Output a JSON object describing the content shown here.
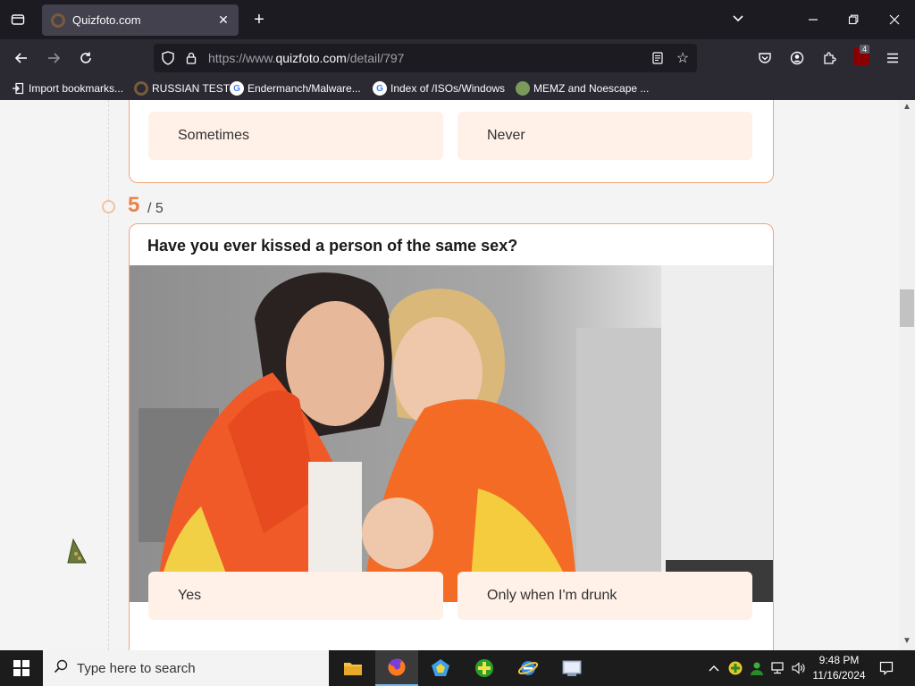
{
  "browser": {
    "tab": {
      "title": "Quizfoto.com"
    },
    "url": {
      "prefix": "https://www.",
      "domain": "quizfoto.com",
      "path": "/detail/797"
    },
    "ublock_badge": "4",
    "bookmarks": [
      {
        "label": "Import bookmarks..."
      },
      {
        "label": "RUSSIAN TEST"
      },
      {
        "label": "Endermanch/Malware..."
      },
      {
        "label": "Index of /ISOs/Windows"
      },
      {
        "label": "MEMZ and Noescape ..."
      }
    ]
  },
  "quiz": {
    "previous_answers": [
      {
        "label": "Sometimes"
      },
      {
        "label": "Never"
      }
    ],
    "question": {
      "number": "5",
      "total": "/ 5",
      "title": "Have you ever kissed a person of the same sex?",
      "image_alt": "Two women wrapped in a rainbow flag",
      "answers": [
        {
          "label": "Yes"
        },
        {
          "label": "Only when I'm drunk"
        }
      ]
    },
    "colors": {
      "accent": "#e86b2c",
      "answer_bg": "#fff0e8",
      "border": "#f2a57a"
    }
  },
  "taskbar": {
    "search_placeholder": "Type here to search",
    "time": "9:48 PM",
    "date": "11/16/2024"
  }
}
